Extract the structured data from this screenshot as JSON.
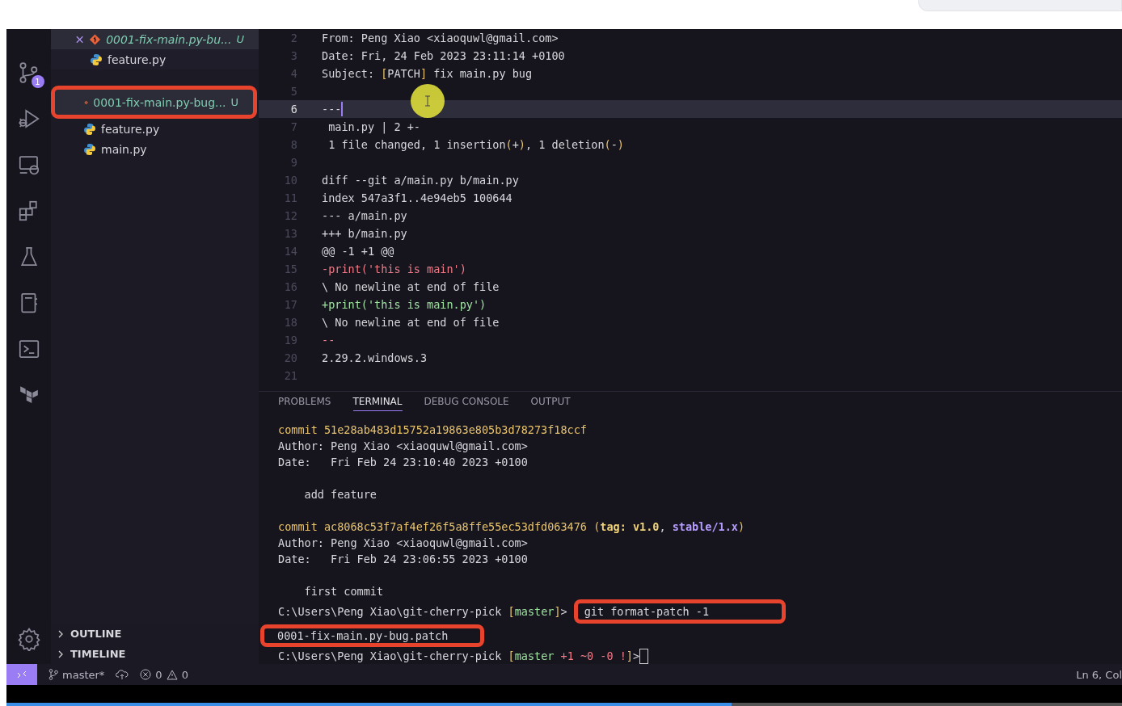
{
  "activity_bar": {
    "source_control_badge": "1"
  },
  "sidebar": {
    "open_editors": [
      {
        "name": "0001-fix-main.py-bu...",
        "kind": "patch",
        "status": "U",
        "active": true,
        "italic": true
      },
      {
        "name": "feature.py",
        "kind": "python",
        "active": false,
        "italic": false
      }
    ],
    "files": [
      {
        "name": "0001-fix-main.py-bug...",
        "kind": "patch",
        "status": "U",
        "selected": true,
        "highlighted": true
      },
      {
        "name": "feature.py",
        "kind": "python",
        "selected": false,
        "highlighted": false
      },
      {
        "name": "main.py",
        "kind": "python",
        "selected": false,
        "highlighted": false
      }
    ],
    "sections": [
      {
        "label": "OUTLINE",
        "expanded": false
      },
      {
        "label": "TIMELINE",
        "expanded": false
      }
    ]
  },
  "editor": {
    "lines": [
      {
        "number": "2",
        "current": false,
        "segments": [
          {
            "text": "From: Peng Xiao <xiaoquwl@gmail.com>"
          }
        ]
      },
      {
        "number": "3",
        "current": false,
        "segments": [
          {
            "text": "Date: Fri, 24 Feb 2023 23:11:14 +0100"
          }
        ]
      },
      {
        "number": "4",
        "current": false,
        "segments": [
          {
            "text": "Subject: "
          },
          {
            "text": "[",
            "color": "#e8c26a"
          },
          {
            "text": "PATCH"
          },
          {
            "text": "]",
            "color": "#e8c26a"
          },
          {
            "text": " fix main.py bug"
          }
        ]
      },
      {
        "number": "5",
        "current": false
      },
      {
        "number": "6",
        "current": true,
        "segments": [
          {
            "text": "---"
          }
        ]
      },
      {
        "number": "7",
        "current": false,
        "segments": [
          {
            "text": " main.py | 2 +-"
          }
        ]
      },
      {
        "number": "8",
        "current": false,
        "segments": [
          {
            "text": " 1 file changed, 1 insertion"
          },
          {
            "text": "(",
            "color": "#e8c26a"
          },
          {
            "text": "+"
          },
          {
            "text": ")",
            "color": "#e8c26a"
          },
          {
            "text": ", 1 deletion"
          },
          {
            "text": "(",
            "color": "#e8c26a"
          },
          {
            "text": "-"
          },
          {
            "text": ")",
            "color": "#e8c26a"
          }
        ]
      },
      {
        "number": "9",
        "current": false
      },
      {
        "number": "10",
        "current": false,
        "segments": [
          {
            "text": "diff --git a/main.py b/main.py"
          }
        ]
      },
      {
        "number": "11",
        "current": false,
        "segments": [
          {
            "text": "index 547a3f1..4e94eb5 100644"
          }
        ]
      },
      {
        "number": "12",
        "current": false,
        "segments": [
          {
            "text": "--- a/main.py"
          }
        ]
      },
      {
        "number": "13",
        "current": false,
        "segments": [
          {
            "text": "+++ b/main.py"
          }
        ]
      },
      {
        "number": "14",
        "current": false,
        "segments": [
          {
            "text": "@@ -1 +1 @@"
          }
        ]
      },
      {
        "number": "15",
        "current": false,
        "segments": [
          {
            "text": "-print('this is main')",
            "color": "#f07a86"
          }
        ]
      },
      {
        "number": "16",
        "current": false,
        "segments": [
          {
            "text": "\\ No newline at end of file"
          }
        ]
      },
      {
        "number": "17",
        "current": false,
        "segments": [
          {
            "text": "+print('this is main.py')",
            "color": "#9fe0a0"
          }
        ]
      },
      {
        "number": "18",
        "current": false,
        "segments": [
          {
            "text": "\\ No newline at end of file"
          }
        ]
      },
      {
        "number": "19",
        "current": false,
        "segments": [
          {
            "text": "--",
            "color": "#f07a86"
          }
        ]
      },
      {
        "number": "20",
        "current": false,
        "segments": [
          {
            "text": "2.29.2.windows.3"
          }
        ]
      },
      {
        "number": "21",
        "current": false
      }
    ]
  },
  "panel": {
    "tabs": [
      {
        "label": "PROBLEMS",
        "selected": false
      },
      {
        "label": "TERMINAL",
        "selected": true
      },
      {
        "label": "DEBUG CONSOLE",
        "selected": false
      },
      {
        "label": "OUTPUT",
        "selected": false
      }
    ],
    "terminal": [
      {
        "kind": "text",
        "highlighted": false,
        "segments": [
          {
            "text": "commit 51e28ab483d15752a19863e805b3d78273f18ccf",
            "color": "#e8c26a"
          }
        ]
      },
      {
        "kind": "text",
        "highlighted": false,
        "segments": [
          {
            "text": "Author: Peng Xiao <xiaoquwl@gmail.com>"
          }
        ]
      },
      {
        "kind": "text",
        "highlighted": false,
        "segments": [
          {
            "text": "Date:   Fri Feb 24 23:10:40 2023 +0100"
          }
        ]
      },
      {
        "kind": "blank"
      },
      {
        "kind": "text",
        "highlighted": false,
        "segments": [
          {
            "text": "    add feature"
          }
        ]
      },
      {
        "kind": "blank"
      },
      {
        "kind": "text",
        "highlighted": false,
        "segments": [
          {
            "text": "commit ac8068c53f7af4ef26f5a8ffe55ec53dfd063476 (",
            "color": "#e8c26a"
          },
          {
            "text": "tag: v1.0",
            "color": "#f0d27a",
            "bold": true
          },
          {
            "text": ", "
          },
          {
            "text": "stable/1.x",
            "color": "#b59cff",
            "bold": true
          },
          {
            "text": ")",
            "color": "#e8c26a"
          }
        ]
      },
      {
        "kind": "text",
        "highlighted": false,
        "segments": [
          {
            "text": "Author: Peng Xiao <xiaoquwl@gmail.com>"
          }
        ]
      },
      {
        "kind": "text",
        "highlighted": false,
        "segments": [
          {
            "text": "Date:   Fri Feb 24 23:06:55 2023 +0100"
          }
        ]
      },
      {
        "kind": "blank"
      },
      {
        "kind": "text",
        "highlighted": false,
        "segments": [
          {
            "text": "    first commit"
          }
        ]
      },
      {
        "kind": "text",
        "highlighted": false,
        "segments": [
          {
            "text": "C:\\Users\\Peng Xiao\\git-cherry-pick "
          },
          {
            "text": "[",
            "color": "#e8c26a"
          },
          {
            "text": "master",
            "color": "#9fe0a0"
          },
          {
            "text": "]",
            "color": "#e8c26a"
          },
          {
            "text": ">"
          }
        ],
        "command": "git format-patch -1",
        "command_highlighted": true
      },
      {
        "kind": "text",
        "highlighted": true,
        "segments": [
          {
            "text": "0001-fix-main.py-bug.patch"
          }
        ]
      },
      {
        "kind": "text",
        "highlighted": false,
        "cursor": true,
        "segments": [
          {
            "text": "C:\\Users\\Peng Xiao\\git-cherry-pick "
          },
          {
            "text": "[",
            "color": "#e8c26a"
          },
          {
            "text": "master",
            "color": "#9fe0a0"
          },
          {
            "text": " +1 ~0 -0 !",
            "color": "#f07a86"
          },
          {
            "text": "]",
            "color": "#e8c26a"
          },
          {
            "text": ">"
          }
        ]
      }
    ]
  },
  "status_bar": {
    "branch": "master*",
    "errors": "0",
    "warnings": "0",
    "position": "Ln 6, Col"
  },
  "video_player": {
    "progress": {
      "level": 0.65
    }
  }
}
